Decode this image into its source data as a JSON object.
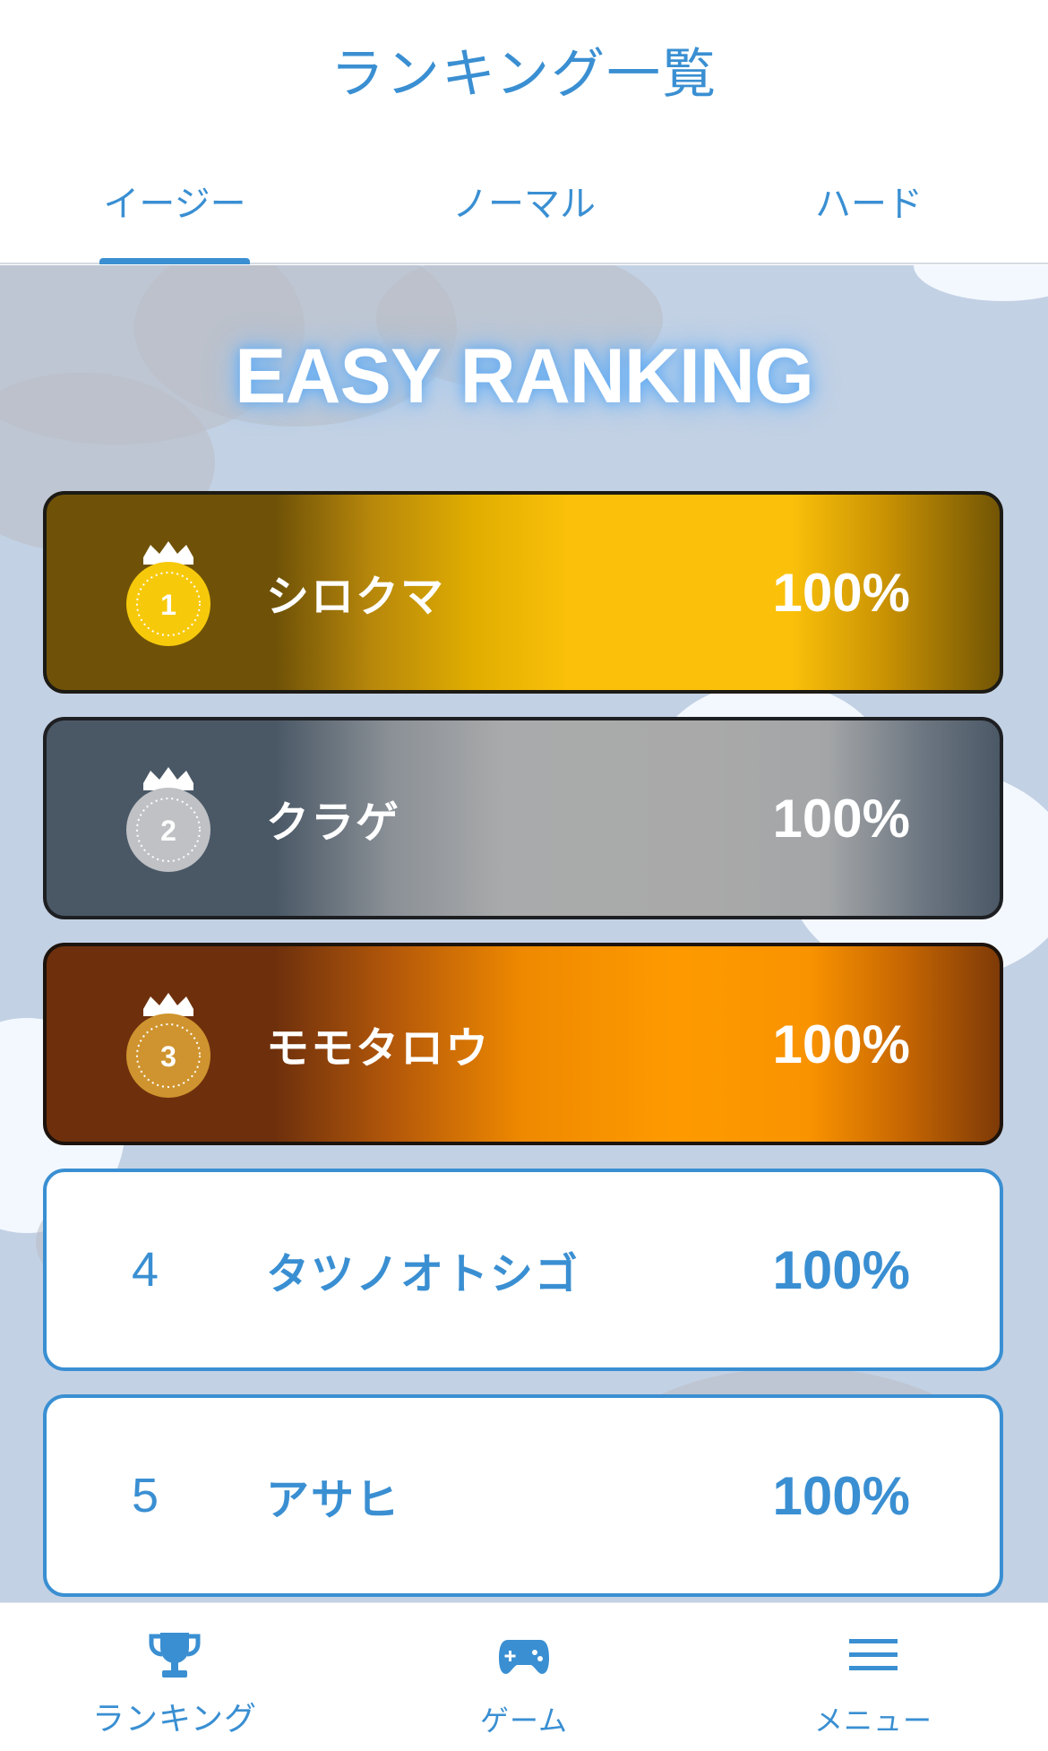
{
  "header": {
    "title": "ランキング一覧"
  },
  "tabs": [
    {
      "label": "イージー",
      "active": true
    },
    {
      "label": "ノーマル",
      "active": false
    },
    {
      "label": "ハード",
      "active": false
    }
  ],
  "ranking": {
    "heading": "EASY RANKING",
    "entries": [
      {
        "rank": "1",
        "name": "シロクマ",
        "score": "100%",
        "medal": "gold"
      },
      {
        "rank": "2",
        "name": "クラゲ",
        "score": "100%",
        "medal": "silver"
      },
      {
        "rank": "3",
        "name": "モモタロウ",
        "score": "100%",
        "medal": "bronze"
      },
      {
        "rank": "4",
        "name": "タツノオトシゴ",
        "score": "100%"
      },
      {
        "rank": "5",
        "name": "アサヒ",
        "score": "100%"
      }
    ]
  },
  "bottom_nav": [
    {
      "label": "ランキング",
      "icon": "trophy-icon",
      "active": true
    },
    {
      "label": "ゲーム",
      "icon": "gamepad-icon",
      "active": false
    },
    {
      "label": "メニュー",
      "icon": "hamburger-menu-icon",
      "active": false
    }
  ],
  "colors": {
    "accent": "#3a8fd2",
    "sky": "#c3d1e4",
    "gold": "#fbc10a",
    "silver": "#a9a9a9",
    "bronze": "#fe9a00"
  }
}
